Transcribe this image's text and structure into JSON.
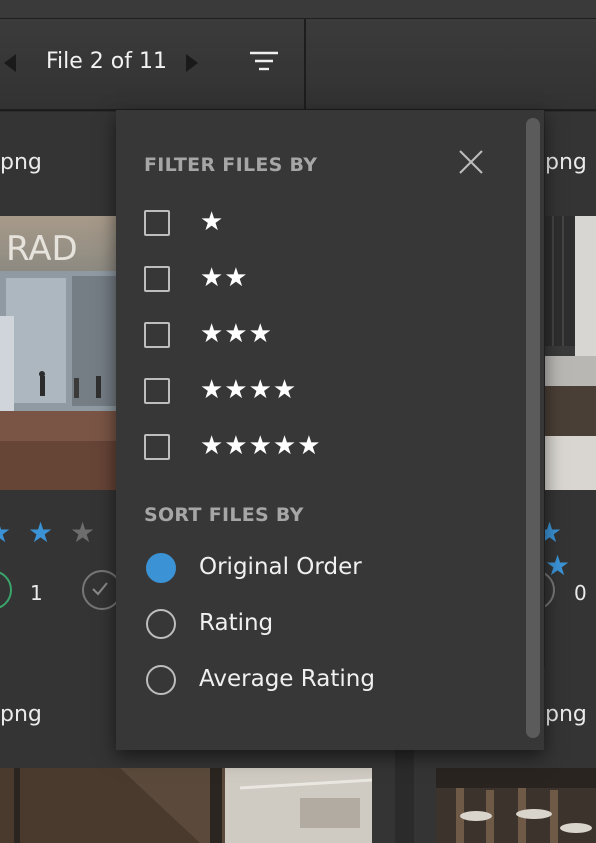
{
  "toolbar": {
    "file_counter": "File 2 of 11",
    "prev_icon": "caret-left-icon",
    "next_icon": "caret-right-icon",
    "filter_icon": "filter-lines-icon"
  },
  "cards": {
    "left_top_name": "png",
    "right_top_name": "png",
    "left_bottom_name": "png",
    "right_bottom_name": "png",
    "left_top_like_count": "1",
    "right_top_like_count": "0"
  },
  "filter_panel": {
    "filter_title": "FILTER FILES BY",
    "sort_title": "SORT FILES BY",
    "close_icon": "close-icon",
    "filter_options": [
      "★",
      "★★",
      "★★★",
      "★★★★",
      "★★★★★"
    ],
    "sort_options": [
      "Original Order",
      "Rating",
      "Average Rating"
    ],
    "selected_sort": "Original Order"
  },
  "colors": {
    "accent": "#3b93d6",
    "panel_bg": "#373737",
    "page_bg": "#2b2b2b"
  }
}
